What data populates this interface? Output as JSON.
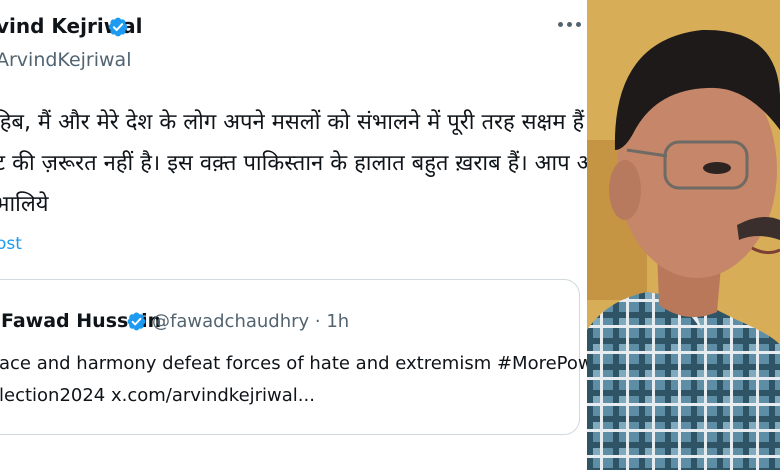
{
  "tweet": {
    "author_name": "vind Kejriwal",
    "author_handle": "ArvindKejriwal",
    "body_lines": [
      "हिब, मैं और मेरे देश के लोग अपने मसलों को संभालने में पूरी तरह सक्षम हैं।",
      "ट की ज़रूरत नहीं है। इस वक़्त पाकिस्तान के हालात बहुत ख़राब हैं। आप अपने",
      "भालिये"
    ],
    "translate_label": "ost"
  },
  "quote": {
    "author_name": "Fawad Hussain",
    "author_handle": "@fawadchaudhry · 1h",
    "text_lines": [
      "ace and harmony defeat forces of hate and extremism #MorePower",
      "lection2024 x.com/arvindkejriwal..."
    ]
  },
  "icons": {
    "verified": "verified-badge-icon",
    "more": "more-options-icon"
  },
  "colors": {
    "verified": "#1d9bf0",
    "link": "#1d9bf0",
    "secondary_text": "#536471"
  }
}
